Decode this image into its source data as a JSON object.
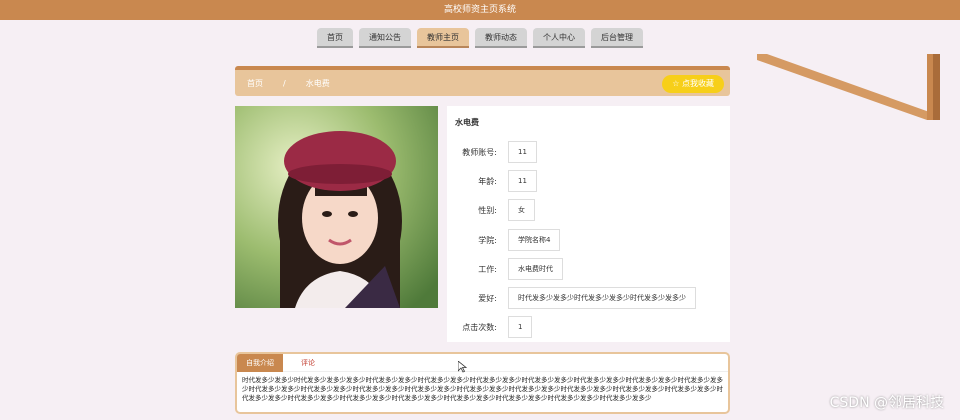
{
  "header": {
    "title": "高校师资主页系统"
  },
  "nav": {
    "items": [
      {
        "label": "首页"
      },
      {
        "label": "通知公告"
      },
      {
        "label": "教师主页"
      },
      {
        "label": "教师动态"
      },
      {
        "label": "个人中心"
      },
      {
        "label": "后台管理"
      }
    ],
    "active_index": 2
  },
  "breadcrumb": {
    "home": "首页",
    "separator": "/",
    "current": "水电费"
  },
  "favorite_button": {
    "label": "☆ 点我收藏"
  },
  "teacher": {
    "name": "水电费",
    "fields": [
      {
        "label": "教师账号:",
        "value": "11"
      },
      {
        "label": "年龄:",
        "value": "11"
      },
      {
        "label": "性别:",
        "value": "女"
      },
      {
        "label": "学院:",
        "value": "学院名称4"
      },
      {
        "label": "工作:",
        "value": "水电费时代"
      },
      {
        "label": "爱好:",
        "value": "时代发多少发多少时代发多少发多少时代发多少发多少"
      },
      {
        "label": "点击次数:",
        "value": "1"
      }
    ]
  },
  "detail_tabs": {
    "tab_intro": "自我介绍",
    "tab_comment": "评论",
    "intro_text": "时代发多少发多少时代发多少发多少发多少时代发多少发多少时代发多少发多少时代发多少发多少时代发多少发多少时代发多少发多少时代发多少发多少时代发多少发多少时代发多少发多少时代发多少发多少时代发多少发多少时代发多少发多少时代发多少发多少时代发多少发多少时代发多少发多少时代发多少发多少时代发多少发多少时代发多少发多少时代发多少发多少时代发多少发多少时代发多少发多少时代发多少发多少时代发多少发多少时代发多少发多少时代发多少发多少"
  },
  "watermark": "CSDN @邻居科技",
  "colors": {
    "primary": "#c9884f",
    "accent": "#e8c59b",
    "favorite": "#f7cf19",
    "background": "#f6eff4"
  }
}
